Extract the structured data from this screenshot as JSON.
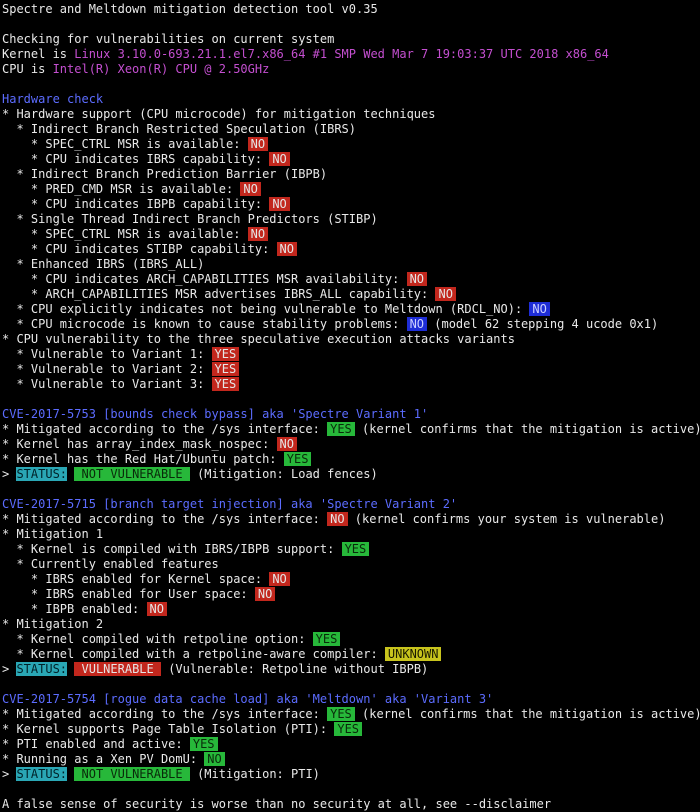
{
  "header": {
    "title": "Spectre and Meltdown mitigation detection tool v0.35",
    "checking": "Checking for vulnerabilities on current system",
    "kernel_prefix": "Kernel is ",
    "kernel_value": "Linux 3.10.0-693.21.1.el7.x86_64 #1 SMP Wed Mar 7 19:03:37 UTC 2018 x86_64",
    "cpu_prefix": "CPU is ",
    "cpu_value": "Intel(R) Xeon(R) CPU @ 2.50GHz"
  },
  "hardware": {
    "heading": "Hardware check",
    "l1": "* Hardware support (CPU microcode) for mitigation techniques",
    "l2": "  * Indirect Branch Restricted Speculation (IBRS)",
    "l3": "    * SPEC_CTRL MSR is available: ",
    "l3b": "NO",
    "l4": "    * CPU indicates IBRS capability: ",
    "l4b": "NO",
    "l5": "  * Indirect Branch Prediction Barrier (IBPB)",
    "l6": "    * PRED_CMD MSR is available: ",
    "l6b": "NO",
    "l7": "    * CPU indicates IBPB capability: ",
    "l7b": "NO",
    "l8": "  * Single Thread Indirect Branch Predictors (STIBP)",
    "l9": "    * SPEC_CTRL MSR is available: ",
    "l9b": "NO",
    "l10": "    * CPU indicates STIBP capability: ",
    "l10b": "NO",
    "l11": "  * Enhanced IBRS (IBRS_ALL)",
    "l12": "    * CPU indicates ARCH_CAPABILITIES MSR availability: ",
    "l12b": "NO",
    "l13": "    * ARCH_CAPABILITIES MSR advertises IBRS_ALL capability: ",
    "l13b": "NO",
    "l14": "  * CPU explicitly indicates not being vulnerable to Meltdown (RDCL_NO): ",
    "l14b": "NO",
    "l15": "  * CPU microcode is known to cause stability problems: ",
    "l15b": "NO",
    "l15c": " (model 62 stepping 4 ucode 0x1)",
    "l16": "* CPU vulnerability to the three speculative execution attacks variants",
    "l17": "  * Vulnerable to Variant 1: ",
    "l17b": "YES",
    "l18": "  * Vulnerable to Variant 2: ",
    "l18b": "YES",
    "l19": "  * Vulnerable to Variant 3: ",
    "l19b": "YES"
  },
  "cve1": {
    "heading": "CVE-2017-5753 [bounds check bypass] aka 'Spectre Variant 1'",
    "l1": "* Mitigated according to the /sys interface: ",
    "l1b": "YES",
    "l1c": " (kernel confirms that the mitigation is active)",
    "l2": "* Kernel has array_index_mask_nospec: ",
    "l2b": "NO",
    "l3": "* Kernel has the Red Hat/Ubuntu patch: ",
    "l3b": "YES",
    "status_prefix": "> ",
    "status_label": "STATUS:",
    "status_value": " NOT VULNERABLE ",
    "status_note": " (Mitigation: Load fences)"
  },
  "cve2": {
    "heading": "CVE-2017-5715 [branch target injection] aka 'Spectre Variant 2'",
    "l1": "* Mitigated according to the /sys interface: ",
    "l1b": "NO",
    "l1c": " (kernel confirms your system is vulnerable)",
    "l2": "* Mitigation 1",
    "l3": "  * Kernel is compiled with IBRS/IBPB support: ",
    "l3b": "YES",
    "l4": "  * Currently enabled features",
    "l5": "    * IBRS enabled for Kernel space: ",
    "l5b": "NO",
    "l6": "    * IBRS enabled for User space: ",
    "l6b": "NO",
    "l7": "    * IBPB enabled: ",
    "l7b": "NO",
    "l8": "* Mitigation 2",
    "l9": "  * Kernel compiled with retpoline option: ",
    "l9b": "YES",
    "l10": "  * Kernel compiled with a retpoline-aware compiler: ",
    "l10b": "UNKNOWN",
    "status_prefix": "> ",
    "status_label": "STATUS:",
    "status_value": " VULNERABLE ",
    "status_note": " (Vulnerable: Retpoline without IBPB)"
  },
  "cve3": {
    "heading": "CVE-2017-5754 [rogue data cache load] aka 'Meltdown' aka 'Variant 3'",
    "l1": "* Mitigated according to the /sys interface: ",
    "l1b": "YES",
    "l1c": " (kernel confirms that the mitigation is active)",
    "l2": "* Kernel supports Page Table Isolation (PTI): ",
    "l2b": "YES",
    "l3": "* PTI enabled and active: ",
    "l3b": "YES",
    "l4": "* Running as a Xen PV DomU: ",
    "l4b": "NO",
    "status_prefix": "> ",
    "status_label": "STATUS:",
    "status_value": " NOT VULNERABLE ",
    "status_note": " (Mitigation: PTI)"
  },
  "footer": {
    "text": "A false sense of security is worse than no security at all, see --disclaimer"
  }
}
